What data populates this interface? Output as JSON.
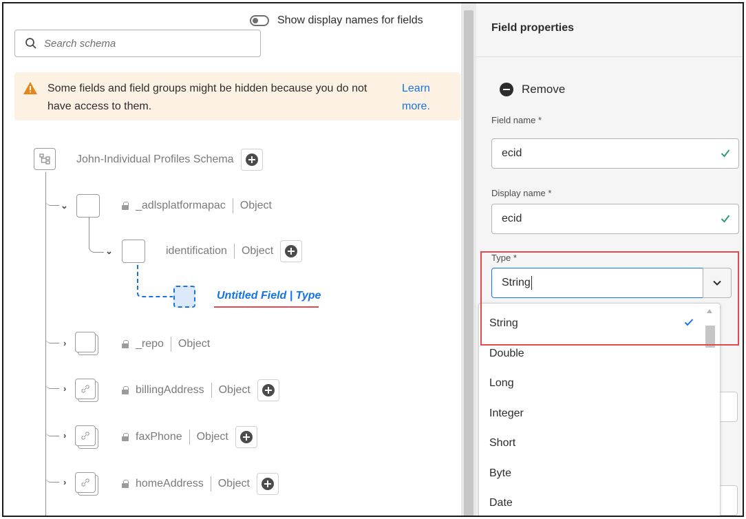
{
  "toggle": {
    "label": "Show display names for fields"
  },
  "search": {
    "placeholder": "Search schema"
  },
  "alert": {
    "message": "Some fields and field groups might be hidden because you do not have access to them.",
    "link": "Learn more."
  },
  "tree": {
    "root": {
      "label": "John-Individual Profiles Schema"
    },
    "nodes": {
      "adls": {
        "name": "_adlsplatformapac",
        "type": "Object"
      },
      "identification": {
        "name": "identification",
        "type": "Object"
      },
      "untitled": {
        "label": "Untitled Field | Type"
      },
      "repo": {
        "name": "_repo",
        "type": "Object"
      },
      "billing": {
        "name": "billingAddress",
        "type": "Object"
      },
      "fax": {
        "name": "faxPhone",
        "type": "Object"
      },
      "home": {
        "name": "homeAddress",
        "type": "Object"
      }
    }
  },
  "properties": {
    "title": "Field properties",
    "remove_label": "Remove",
    "field_name_label": "Field name",
    "field_name_value": "ecid",
    "display_name_label": "Display name",
    "display_name_value": "ecid",
    "type_label": "Type",
    "type_value": "String",
    "required_marker": "*"
  },
  "type_options": [
    "String",
    "Double",
    "Long",
    "Integer",
    "Short",
    "Byte",
    "Date"
  ],
  "colors": {
    "accent": "#1473e6",
    "alert_bg": "#fdf1e4",
    "warning": "#e68619",
    "valid": "#2d9d78",
    "highlight": "#e34850"
  }
}
